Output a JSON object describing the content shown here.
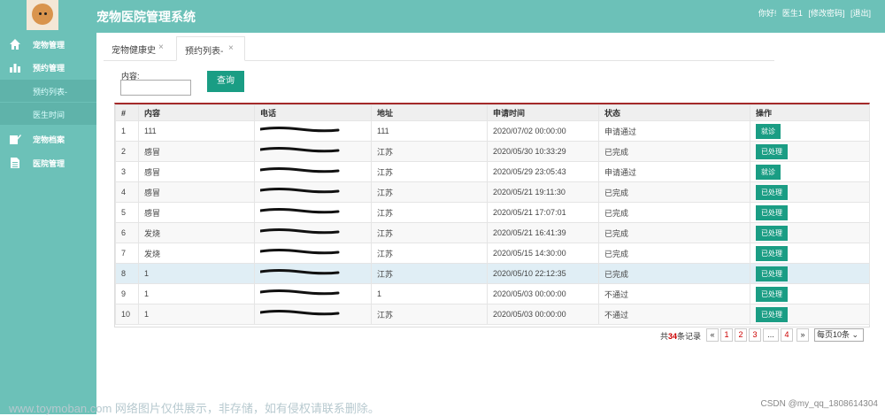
{
  "header": {
    "app_title": "宠物医院管理系统",
    "greeting": "你好!",
    "username": "医生1",
    "change_password": "[修改密码]",
    "logout": "[退出]"
  },
  "sidebar": {
    "items": [
      {
        "label": "宠物管理",
        "icon": "home-icon"
      },
      {
        "label": "预约管理",
        "icon": "bar-chart-icon"
      },
      {
        "label": "预约列表-",
        "icon": ""
      },
      {
        "label": "医生时间",
        "icon": ""
      },
      {
        "label": "宠物档案",
        "icon": "pencil-icon"
      },
      {
        "label": "医院管理",
        "icon": "document-icon"
      }
    ]
  },
  "tabs": [
    {
      "label": "宠物健康史"
    },
    {
      "label": "预约列表-"
    }
  ],
  "tab_close_glyph": "×",
  "search": {
    "label": "内容:",
    "value": "",
    "button": "查询"
  },
  "table": {
    "columns": [
      "#",
      "内容",
      "电话",
      "地址",
      "申请时间",
      "状态",
      "操作"
    ],
    "rows": [
      {
        "no": "1",
        "content": "111",
        "phone": "",
        "address": "111",
        "time": "2020/07/02 00:00:00",
        "status": "申请通过",
        "action": "就诊"
      },
      {
        "no": "2",
        "content": "感冒",
        "phone": "",
        "address": "江苏",
        "time": "2020/05/30 10:33:29",
        "status": "已完成",
        "action": "已处理"
      },
      {
        "no": "3",
        "content": "感冒",
        "phone": "",
        "address": "江苏",
        "time": "2020/05/29 23:05:43",
        "status": "申请通过",
        "action": "就诊"
      },
      {
        "no": "4",
        "content": "感冒",
        "phone": "",
        "address": "江苏",
        "time": "2020/05/21 19:11:30",
        "status": "已完成",
        "action": "已处理"
      },
      {
        "no": "5",
        "content": "感冒",
        "phone": "",
        "address": "江苏",
        "time": "2020/05/21 17:07:01",
        "status": "已完成",
        "action": "已处理"
      },
      {
        "no": "6",
        "content": "发烧",
        "phone": "",
        "address": "江苏",
        "time": "2020/05/21 16:41:39",
        "status": "已完成",
        "action": "已处理"
      },
      {
        "no": "7",
        "content": "发烧",
        "phone": "",
        "address": "江苏",
        "time": "2020/05/15 14:30:00",
        "status": "已完成",
        "action": "已处理"
      },
      {
        "no": "8",
        "content": "1",
        "phone": "",
        "address": "江苏",
        "time": "2020/05/10 22:12:35",
        "status": "已完成",
        "action": "已处理"
      },
      {
        "no": "9",
        "content": "1",
        "phone": "",
        "address": "1",
        "time": "2020/05/03 00:00:00",
        "status": "不通过",
        "action": "已处理"
      },
      {
        "no": "10",
        "content": "1",
        "phone": "",
        "address": "江苏",
        "time": "2020/05/03 00:00:00",
        "status": "不通过",
        "action": "已处理"
      }
    ]
  },
  "pager": {
    "prefix": "共",
    "total": "34",
    "suffix": "条记录",
    "first": "«",
    "pages": [
      "1",
      "2",
      "3"
    ],
    "ellipsis": "...",
    "last_page": "4",
    "last": "»",
    "per_page": "每页10条"
  },
  "watermark": "www.toymoban.com 网络图片仅供展示，非存储，如有侵权请联系删除。",
  "credit": "CSDN @my_qq_1808614304",
  "colors": {
    "theme": "#6cc1b8",
    "button": "#1a9d84",
    "table_top_border": "#a42a2a",
    "highlight_row": "#e0eef5"
  }
}
